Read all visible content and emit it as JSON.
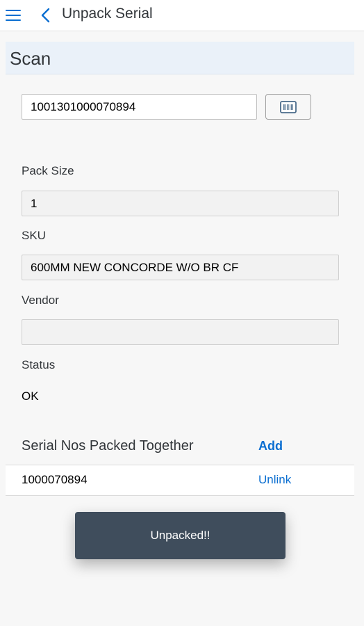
{
  "header": {
    "title": "Unpack Serial",
    "menu_icon": "hamburger-icon",
    "back_icon": "chevron-left-icon"
  },
  "section": {
    "title": "Scan"
  },
  "scan": {
    "value": "1001301000070894",
    "button_icon": "barcode-icon"
  },
  "fields": {
    "pack_size_label": "Pack Size",
    "pack_size_value": "1",
    "sku_label": "SKU",
    "sku_value": "600MM NEW CONCORDE W/O BR CF",
    "vendor_label": "Vendor",
    "vendor_value": "",
    "status_label": "Status",
    "status_value": "OK"
  },
  "serial_list": {
    "title": "Serial Nos Packed Together",
    "add_label": "Add",
    "items": [
      {
        "serial": "1000070894",
        "action": "Unlink"
      }
    ]
  },
  "toast": {
    "message": "Unpacked!!"
  },
  "colors": {
    "accent": "#0a6ed1",
    "section_bg": "#eaf1f9",
    "toast_bg": "#3f4d5c"
  }
}
